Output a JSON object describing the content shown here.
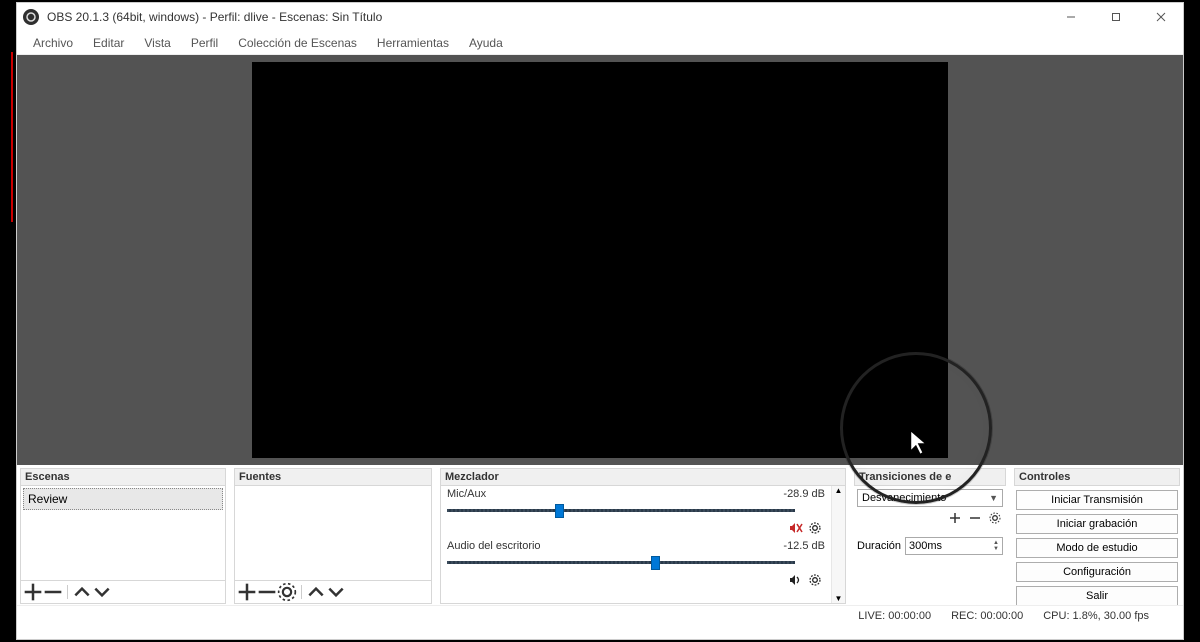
{
  "title": "OBS 20.1.3 (64bit, windows) - Perfil: dlive - Escenas: Sin Título",
  "menu": {
    "archivo": "Archivo",
    "editar": "Editar",
    "vista": "Vista",
    "perfil": "Perfil",
    "coleccion": "Colección de Escenas",
    "herramientas": "Herramientas",
    "ayuda": "Ayuda"
  },
  "panels": {
    "escenas": {
      "title": "Escenas",
      "item0": "Review"
    },
    "fuentes": {
      "title": "Fuentes"
    },
    "mezclador": {
      "title": "Mezclador",
      "track0": {
        "name": "Mic/Aux",
        "db": "-28.9 dB"
      },
      "track1": {
        "name": "Audio del escritorio",
        "db": "-12.5 dB"
      }
    },
    "transiciones": {
      "title": "Transiciones de e",
      "combo": "Desvanecimiento",
      "duracion_label": "Duración",
      "duracion_value": "300ms"
    },
    "controles": {
      "title": "Controles",
      "btn_transmit": "Iniciar Transmisión",
      "btn_record": "Iniciar grabación",
      "btn_studio": "Modo de estudio",
      "btn_config": "Configuración",
      "btn_exit": "Salir"
    }
  },
  "status": {
    "live": "LIVE: 00:00:00",
    "rec": "REC: 00:00:00",
    "cpu": "CPU: 1.8%, 30.00 fps"
  }
}
